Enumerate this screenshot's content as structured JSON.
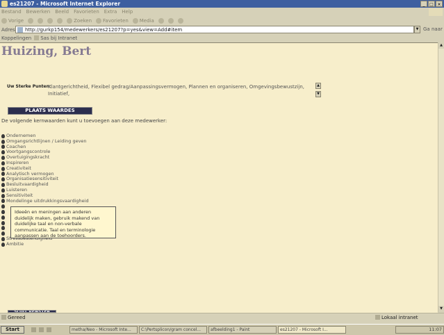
{
  "window": {
    "title": "es21207 - Microsoft Internet Explorer",
    "controls": [
      "_",
      "□",
      "×"
    ]
  },
  "menu": [
    "Bestand",
    "Bewerken",
    "Beeld",
    "Favorieten",
    "Extra",
    "Help"
  ],
  "toolbar": {
    "back": "Vorige",
    "search": "Zoeken",
    "favorites": "Favorieten",
    "media": "Media"
  },
  "address": {
    "label": "Adres",
    "url": "http://gurkp154/medewerkers/es21207?p=yes&view=Add#item",
    "go": "Ga naar"
  },
  "links": {
    "label": "Koppelingen",
    "item": "Sas bij Intranet"
  },
  "page": {
    "employee_name": "Huizing, Bert",
    "strengths_label": "Uw Sterke Punten:",
    "strengths_value": "Klantgerichtheid, Flexibel gedrag/Aanpassingsvermogen, Plannen en organiseren, Omgevingsbewustzijn, Initiatief,",
    "place_values_button": "PLAATS WAARDES",
    "intro": "De volgende kernwaarden kunt u toevoegen aan deze medewerker:",
    "values": [
      "Ondernemen",
      "Omgangsrichtlijnen / Leiding geven",
      "Coachen",
      "Voortgangscontrole",
      "Overtuigingskracht",
      "Inspireren",
      "Creativiteit",
      "Analytisch vermogen",
      "Organisatiesensitiviteit",
      "Besluitvaardigheid",
      "Luisteren",
      "Sensitiviteit",
      "Mondelinge uitdrukkingsvaardigheid",
      "",
      "",
      "",
      "",
      "",
      "",
      "Stressbestendigheid",
      "Ambitie"
    ],
    "tooltip": [
      "Ideeën en meningen aan anderen",
      "duidelijk maken, gebruik makend van",
      "duidelijke taal en non-verbale",
      "communicatie. Taal en terminologie",
      "aanpassen aan de toehoorders."
    ],
    "close_button": "SLUIT VENSTER"
  },
  "status": {
    "left": "Gereed",
    "zone": "Lokaal intranet"
  },
  "taskbar": {
    "start": "Start",
    "tasks": [
      "metha/Neo - Microsoft Inte...",
      "C:\\Pertsplicon/gram concel...",
      "afbeelding1 - Paint",
      "es21207 - Microsoft I..."
    ],
    "clock": "11:07"
  }
}
